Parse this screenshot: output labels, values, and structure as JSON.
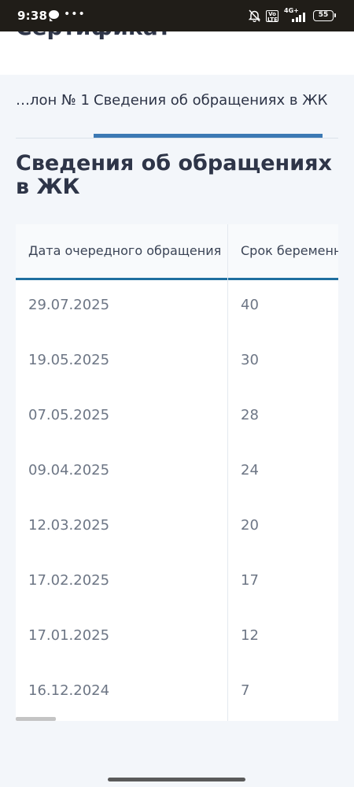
{
  "status_bar": {
    "time": "9:38",
    "volte_label": "Vo LTE",
    "network_label": "4G+",
    "battery_level": "55",
    "icons": [
      "chat-icon",
      "more-dots-icon",
      "bell-muted-icon",
      "volte-icon",
      "signal-icon",
      "battery-icon"
    ]
  },
  "header": {
    "title_partial": "Сертификат"
  },
  "tabs": [
    {
      "label": "…лон № 1",
      "active": false
    },
    {
      "label": "Сведения об обращениях в ЖК",
      "active": true
    }
  ],
  "section": {
    "title": "Сведения об обращениях в ЖК"
  },
  "table": {
    "columns": [
      "Дата очередного обращения",
      "Срок беременн"
    ],
    "rows": [
      {
        "date": "29.07.2025",
        "term": "40"
      },
      {
        "date": "19.05.2025",
        "term": "30"
      },
      {
        "date": "07.05.2025",
        "term": "28"
      },
      {
        "date": "09.04.2025",
        "term": "24"
      },
      {
        "date": "12.03.2025",
        "term": "20"
      },
      {
        "date": "17.02.2025",
        "term": "17"
      },
      {
        "date": "17.01.2025",
        "term": "12"
      },
      {
        "date": "16.12.2024",
        "term": "7"
      }
    ]
  },
  "colors": {
    "accent": "#3c79b4",
    "header_line": "#1f6fa0",
    "title": "#2e3548",
    "muted_text": "#6d7685",
    "background": "#f3f6fa"
  }
}
